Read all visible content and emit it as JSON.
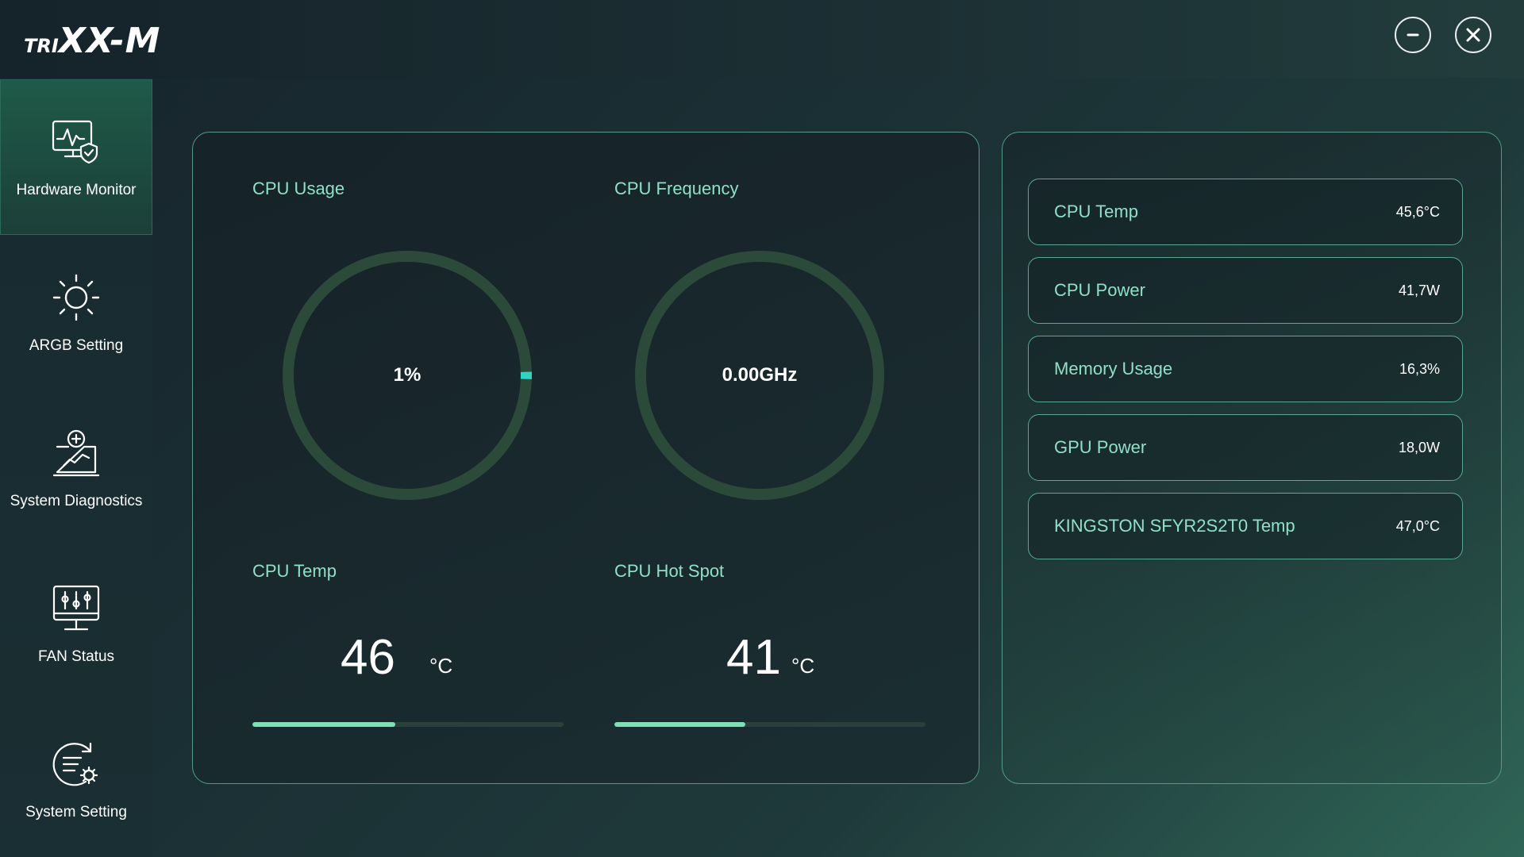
{
  "app": {
    "logo_main": "TRIXX-M",
    "logo_prefix": "TRI",
    "logo_suffix": "XX-M"
  },
  "window_controls": {
    "minimize_icon": "minus-icon",
    "close_icon": "close-icon"
  },
  "sidebar": {
    "items": [
      {
        "label": "Hardware Monitor",
        "icon": "monitor-shield-icon",
        "active": true
      },
      {
        "label": "ARGB Setting",
        "icon": "sun-icon",
        "active": false
      },
      {
        "label": "System Diagnostics",
        "icon": "diagnostics-icon",
        "active": false
      },
      {
        "label": "FAN Status",
        "icon": "sliders-icon",
        "active": false
      },
      {
        "label": "System Setting",
        "icon": "settings-gear-icon",
        "active": false
      }
    ]
  },
  "monitor": {
    "cpu_usage": {
      "title": "CPU Usage",
      "value": "1%",
      "percent": 1
    },
    "cpu_frequency": {
      "title": "CPU Frequency",
      "value": "0.00GHz",
      "percent": 0
    },
    "cpu_temp": {
      "title": "CPU Temp",
      "value": "46",
      "unit": "°C",
      "percent": 46
    },
    "cpu_hotspot": {
      "title": "CPU Hot Spot",
      "value": "41",
      "unit": "°C",
      "percent": 42
    }
  },
  "stats": [
    {
      "label": "CPU Temp",
      "value": "45,6°C"
    },
    {
      "label": "CPU Power",
      "value": "41,7W"
    },
    {
      "label": "Memory Usage",
      "value": "16,3%"
    },
    {
      "label": "GPU Power",
      "value": "18,0W"
    },
    {
      "label": "KINGSTON SFYR2S2T0 Temp",
      "value": "47,0°C"
    }
  ],
  "colors": {
    "accent": "#8fe0c6",
    "gauge_track": "#2c4a3a",
    "gauge_indicator": "#2fd4c2",
    "bar_fill": "#7fe0b5",
    "panel_border": "#4f9c8a"
  }
}
